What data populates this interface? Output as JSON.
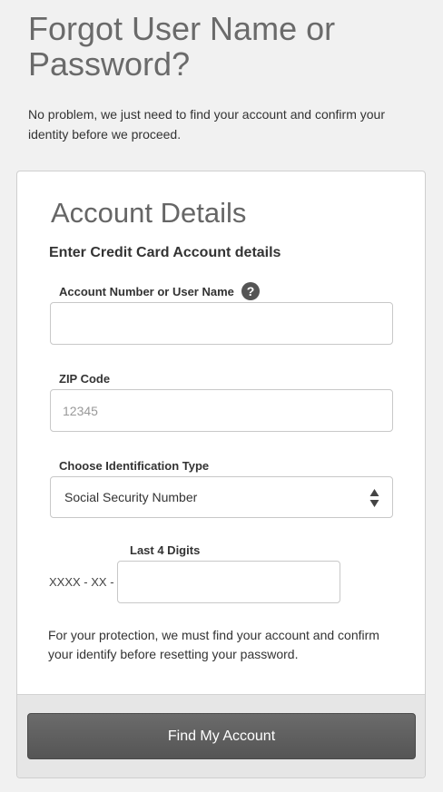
{
  "page": {
    "title": "Forgot User Name or Password?",
    "intro": "No problem, we just need to find your account and confirm your identity before we proceed."
  },
  "account_details": {
    "title": "Account Details",
    "subtitle": "Enter Credit Card Account details",
    "account_field": {
      "label": "Account Number or User Name",
      "value": "",
      "placeholder": "",
      "help_icon": "question-mark-icon"
    },
    "zip_field": {
      "label": "ZIP Code",
      "value": "",
      "placeholder": "12345"
    },
    "id_type": {
      "label": "Choose Identification Type",
      "selected": "Social Security Number"
    },
    "last4": {
      "label": "Last 4 Digits",
      "prefix": "XXXX - XX -",
      "value": ""
    },
    "note": "For your protection, we must find your account and confirm your identify before resetting your password.",
    "submit_label": "Find My Account"
  },
  "colors": {
    "background": "#f1f1f1",
    "button": "#5e5e5e",
    "footer": "#e6e6e6"
  }
}
